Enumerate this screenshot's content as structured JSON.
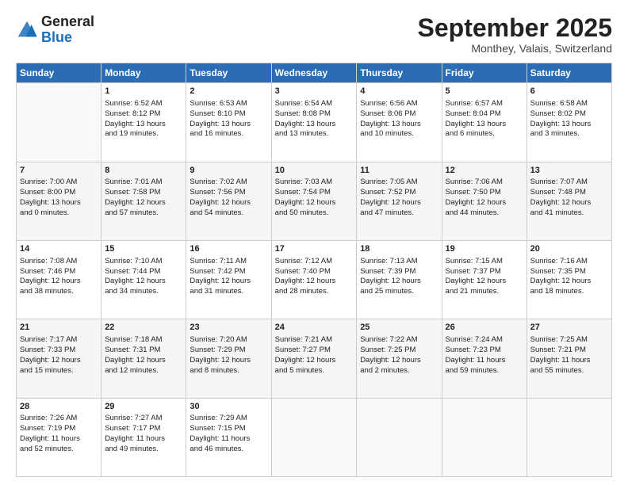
{
  "header": {
    "logo_general": "General",
    "logo_blue": "Blue",
    "month": "September 2025",
    "location": "Monthey, Valais, Switzerland"
  },
  "days_of_week": [
    "Sunday",
    "Monday",
    "Tuesday",
    "Wednesday",
    "Thursday",
    "Friday",
    "Saturday"
  ],
  "weeks": [
    [
      {
        "day": "",
        "data": ""
      },
      {
        "day": "1",
        "data": "Sunrise: 6:52 AM\nSunset: 8:12 PM\nDaylight: 13 hours\nand 19 minutes."
      },
      {
        "day": "2",
        "data": "Sunrise: 6:53 AM\nSunset: 8:10 PM\nDaylight: 13 hours\nand 16 minutes."
      },
      {
        "day": "3",
        "data": "Sunrise: 6:54 AM\nSunset: 8:08 PM\nDaylight: 13 hours\nand 13 minutes."
      },
      {
        "day": "4",
        "data": "Sunrise: 6:56 AM\nSunset: 8:06 PM\nDaylight: 13 hours\nand 10 minutes."
      },
      {
        "day": "5",
        "data": "Sunrise: 6:57 AM\nSunset: 8:04 PM\nDaylight: 13 hours\nand 6 minutes."
      },
      {
        "day": "6",
        "data": "Sunrise: 6:58 AM\nSunset: 8:02 PM\nDaylight: 13 hours\nand 3 minutes."
      }
    ],
    [
      {
        "day": "7",
        "data": "Sunrise: 7:00 AM\nSunset: 8:00 PM\nDaylight: 13 hours\nand 0 minutes."
      },
      {
        "day": "8",
        "data": "Sunrise: 7:01 AM\nSunset: 7:58 PM\nDaylight: 12 hours\nand 57 minutes."
      },
      {
        "day": "9",
        "data": "Sunrise: 7:02 AM\nSunset: 7:56 PM\nDaylight: 12 hours\nand 54 minutes."
      },
      {
        "day": "10",
        "data": "Sunrise: 7:03 AM\nSunset: 7:54 PM\nDaylight: 12 hours\nand 50 minutes."
      },
      {
        "day": "11",
        "data": "Sunrise: 7:05 AM\nSunset: 7:52 PM\nDaylight: 12 hours\nand 47 minutes."
      },
      {
        "day": "12",
        "data": "Sunrise: 7:06 AM\nSunset: 7:50 PM\nDaylight: 12 hours\nand 44 minutes."
      },
      {
        "day": "13",
        "data": "Sunrise: 7:07 AM\nSunset: 7:48 PM\nDaylight: 12 hours\nand 41 minutes."
      }
    ],
    [
      {
        "day": "14",
        "data": "Sunrise: 7:08 AM\nSunset: 7:46 PM\nDaylight: 12 hours\nand 38 minutes."
      },
      {
        "day": "15",
        "data": "Sunrise: 7:10 AM\nSunset: 7:44 PM\nDaylight: 12 hours\nand 34 minutes."
      },
      {
        "day": "16",
        "data": "Sunrise: 7:11 AM\nSunset: 7:42 PM\nDaylight: 12 hours\nand 31 minutes."
      },
      {
        "day": "17",
        "data": "Sunrise: 7:12 AM\nSunset: 7:40 PM\nDaylight: 12 hours\nand 28 minutes."
      },
      {
        "day": "18",
        "data": "Sunrise: 7:13 AM\nSunset: 7:39 PM\nDaylight: 12 hours\nand 25 minutes."
      },
      {
        "day": "19",
        "data": "Sunrise: 7:15 AM\nSunset: 7:37 PM\nDaylight: 12 hours\nand 21 minutes."
      },
      {
        "day": "20",
        "data": "Sunrise: 7:16 AM\nSunset: 7:35 PM\nDaylight: 12 hours\nand 18 minutes."
      }
    ],
    [
      {
        "day": "21",
        "data": "Sunrise: 7:17 AM\nSunset: 7:33 PM\nDaylight: 12 hours\nand 15 minutes."
      },
      {
        "day": "22",
        "data": "Sunrise: 7:18 AM\nSunset: 7:31 PM\nDaylight: 12 hours\nand 12 minutes."
      },
      {
        "day": "23",
        "data": "Sunrise: 7:20 AM\nSunset: 7:29 PM\nDaylight: 12 hours\nand 8 minutes."
      },
      {
        "day": "24",
        "data": "Sunrise: 7:21 AM\nSunset: 7:27 PM\nDaylight: 12 hours\nand 5 minutes."
      },
      {
        "day": "25",
        "data": "Sunrise: 7:22 AM\nSunset: 7:25 PM\nDaylight: 12 hours\nand 2 minutes."
      },
      {
        "day": "26",
        "data": "Sunrise: 7:24 AM\nSunset: 7:23 PM\nDaylight: 11 hours\nand 59 minutes."
      },
      {
        "day": "27",
        "data": "Sunrise: 7:25 AM\nSunset: 7:21 PM\nDaylight: 11 hours\nand 55 minutes."
      }
    ],
    [
      {
        "day": "28",
        "data": "Sunrise: 7:26 AM\nSunset: 7:19 PM\nDaylight: 11 hours\nand 52 minutes."
      },
      {
        "day": "29",
        "data": "Sunrise: 7:27 AM\nSunset: 7:17 PM\nDaylight: 11 hours\nand 49 minutes."
      },
      {
        "day": "30",
        "data": "Sunrise: 7:29 AM\nSunset: 7:15 PM\nDaylight: 11 hours\nand 46 minutes."
      },
      {
        "day": "",
        "data": ""
      },
      {
        "day": "",
        "data": ""
      },
      {
        "day": "",
        "data": ""
      },
      {
        "day": "",
        "data": ""
      }
    ]
  ]
}
